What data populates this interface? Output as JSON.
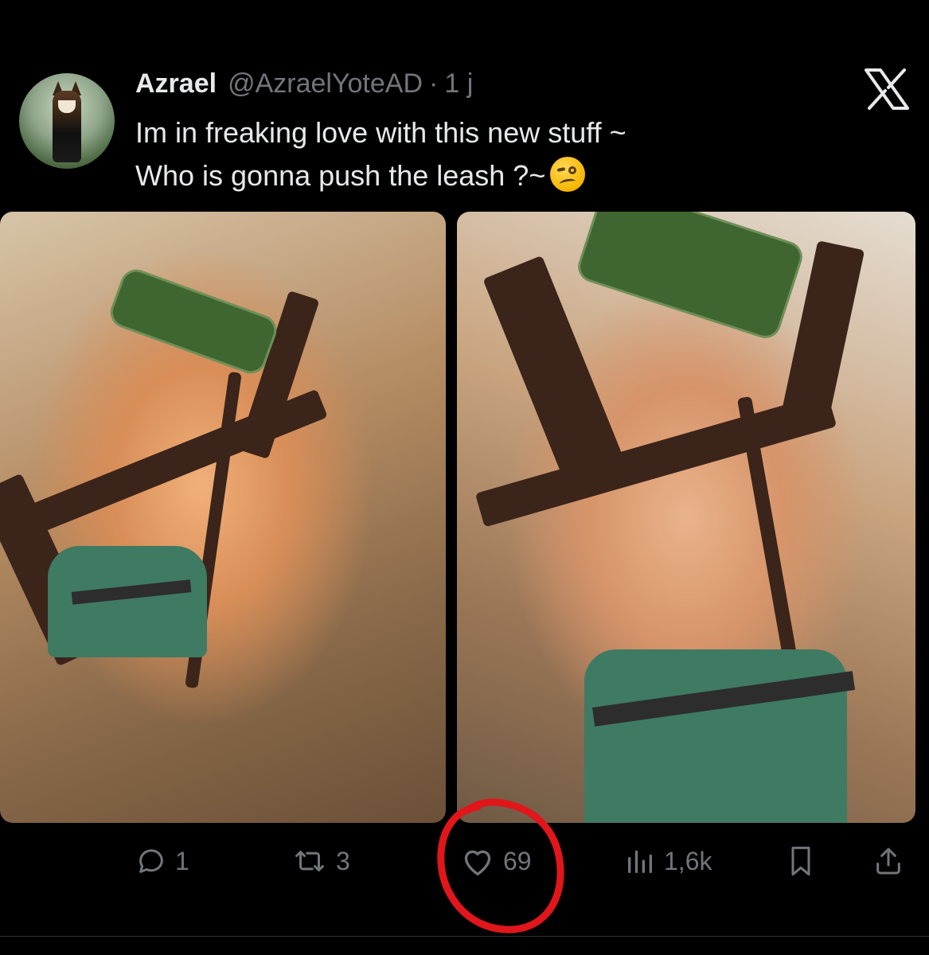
{
  "tweet": {
    "author": {
      "name": "Azrael",
      "handle": "@AzraelYoteAD",
      "time": "1 j",
      "separator": "·"
    },
    "text_lines": [
      "Im in freaking love with this new stuff ~",
      "Who is gonna push the leash ?~"
    ],
    "emoji": "woozy-face"
  },
  "actions": {
    "replies": "1",
    "retweets": "3",
    "likes": "69",
    "views": "1,6k"
  },
  "icons": {
    "close": "x-close-icon",
    "reply": "comment-icon",
    "retweet": "retweet-icon",
    "like": "heart-icon",
    "views": "bar-chart-icon",
    "bookmark": "bookmark-icon",
    "share": "share-icon"
  },
  "colors": {
    "background": "#000000",
    "text": "#e7e9ea",
    "secondary": "#71767b",
    "highlight": "#e0161b"
  }
}
